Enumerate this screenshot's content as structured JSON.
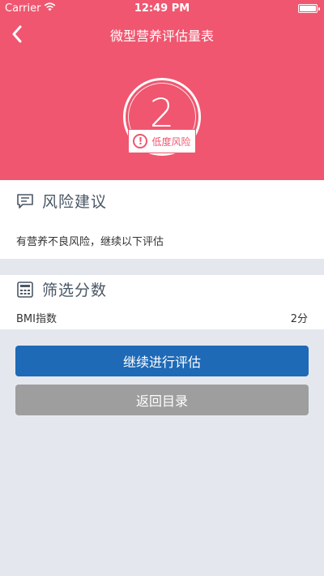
{
  "status_bar": {
    "carrier": "Carrier",
    "time": "12:49 PM"
  },
  "nav": {
    "title": "微型营养评估量表"
  },
  "score": {
    "value": "2",
    "risk_label": "低度风险"
  },
  "risk_section": {
    "title": "风险建议",
    "advice": "有营养不良风险，继续以下评估"
  },
  "score_section": {
    "title": "筛选分数",
    "rows": [
      {
        "label": "BMI指数",
        "value": "2分"
      }
    ]
  },
  "actions": {
    "continue_label": "继续进行评估",
    "back_label": "返回目录"
  },
  "colors": {
    "header": "#f0566f",
    "primary_button": "#1e6ab7",
    "secondary_button": "#9e9e9e",
    "page_background": "#e4e8ee"
  },
  "icons": {
    "back": "chevron-left-icon",
    "wifi": "wifi-icon",
    "battery": "battery-icon",
    "risk": "exclamation-circle-icon",
    "risk_section": "chat-bubble-icon",
    "score_section": "calculator-icon"
  }
}
